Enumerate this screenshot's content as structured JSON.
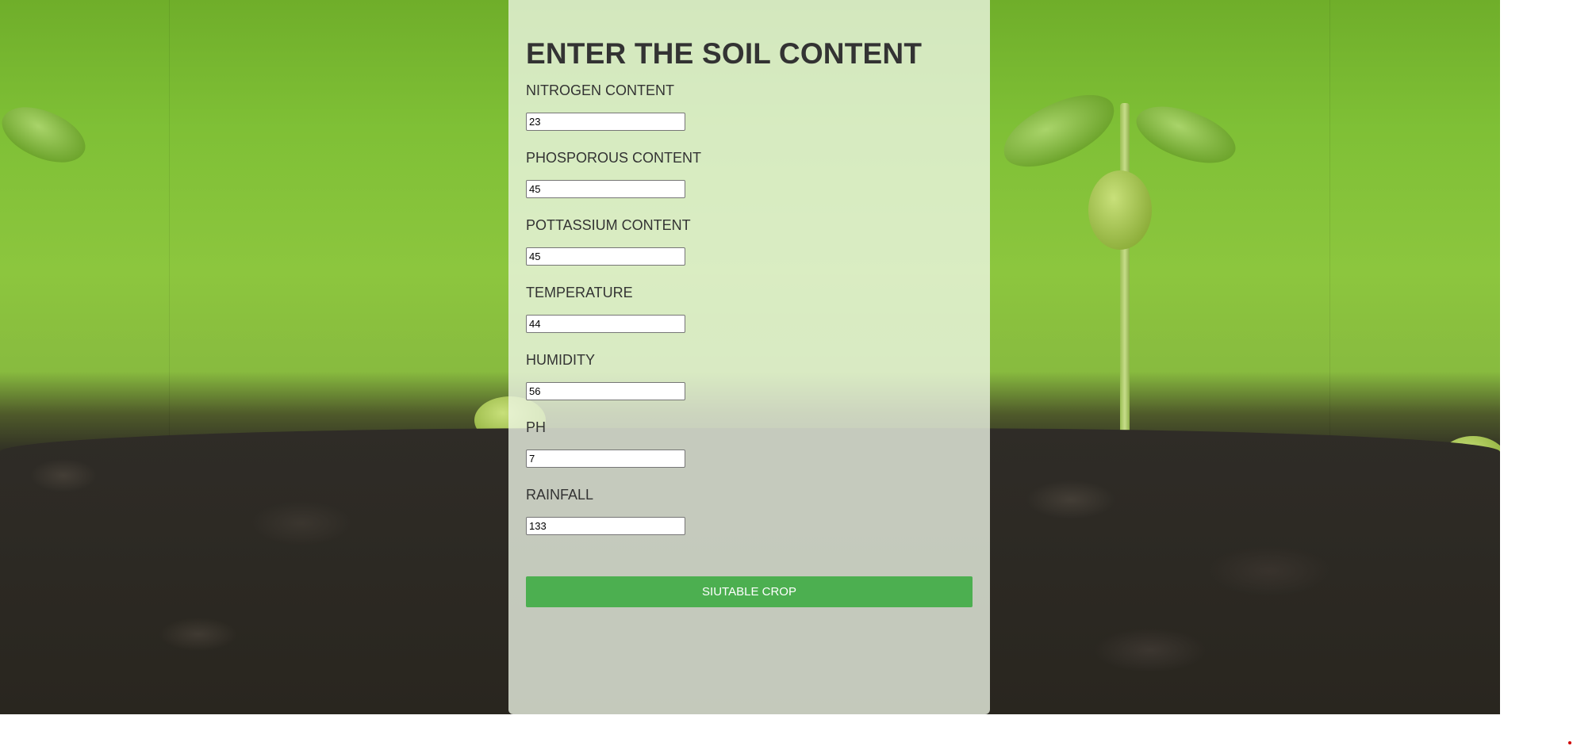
{
  "form": {
    "title": "ENTER THE SOIL CONTENT",
    "fields": [
      {
        "label": "NITROGEN CONTENT",
        "value": "23"
      },
      {
        "label": "PHOSPOROUS CONTENT",
        "value": "45"
      },
      {
        "label": "POTTASSIUM CONTENT",
        "value": "45"
      },
      {
        "label": "TEMPERATURE",
        "value": "44"
      },
      {
        "label": "HUMIDITY",
        "value": "56"
      },
      {
        "label": "PH",
        "value": "7"
      },
      {
        "label": "RAINFALL",
        "value": "133"
      }
    ],
    "submit_label": "SIUTABLE CROP"
  },
  "colors": {
    "button": "#4caf50",
    "card_overlay": "#f0f7e8",
    "text": "#333333"
  }
}
